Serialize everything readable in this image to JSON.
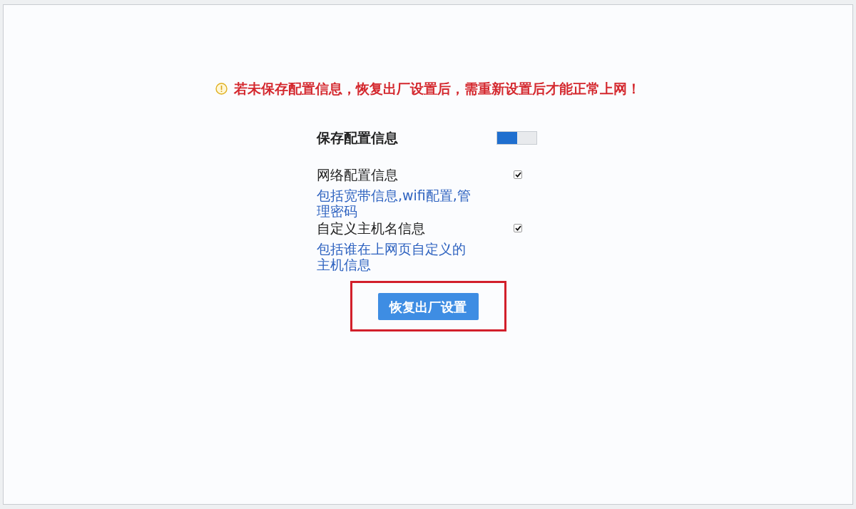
{
  "warning": {
    "text": "若未保存配置信息，恢复出厂设置后，需重新设置后才能正常上网！"
  },
  "save_config": {
    "label": "保存配置信息",
    "on": true
  },
  "options": [
    {
      "label": "网络配置信息",
      "description": "包括宽带信息,wifi配置,管理密码",
      "checked": true
    },
    {
      "label": "自定义主机名信息",
      "description": "包括谁在上网页自定义的主机信息",
      "checked": true
    }
  ],
  "reset_button": {
    "label": "恢复出厂设置",
    "highlighted": true
  }
}
